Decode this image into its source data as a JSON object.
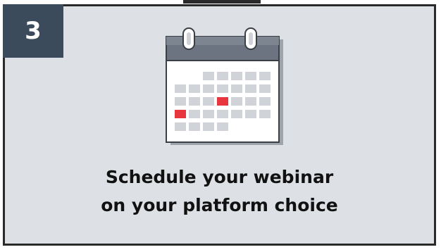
{
  "step": {
    "number": "3"
  },
  "caption": {
    "line1": "Schedule your webinar",
    "line2": "on your platform choice"
  },
  "icon": "calendar-icon",
  "colors": {
    "card_background": "#dde0e4",
    "card_border": "#2a2a2a",
    "badge_background": "#3c4b5c",
    "badge_text": "#ffffff",
    "calendar_header": "#6b7480",
    "calendar_cell": "#d0d3d8",
    "highlight": "#e8363f"
  }
}
